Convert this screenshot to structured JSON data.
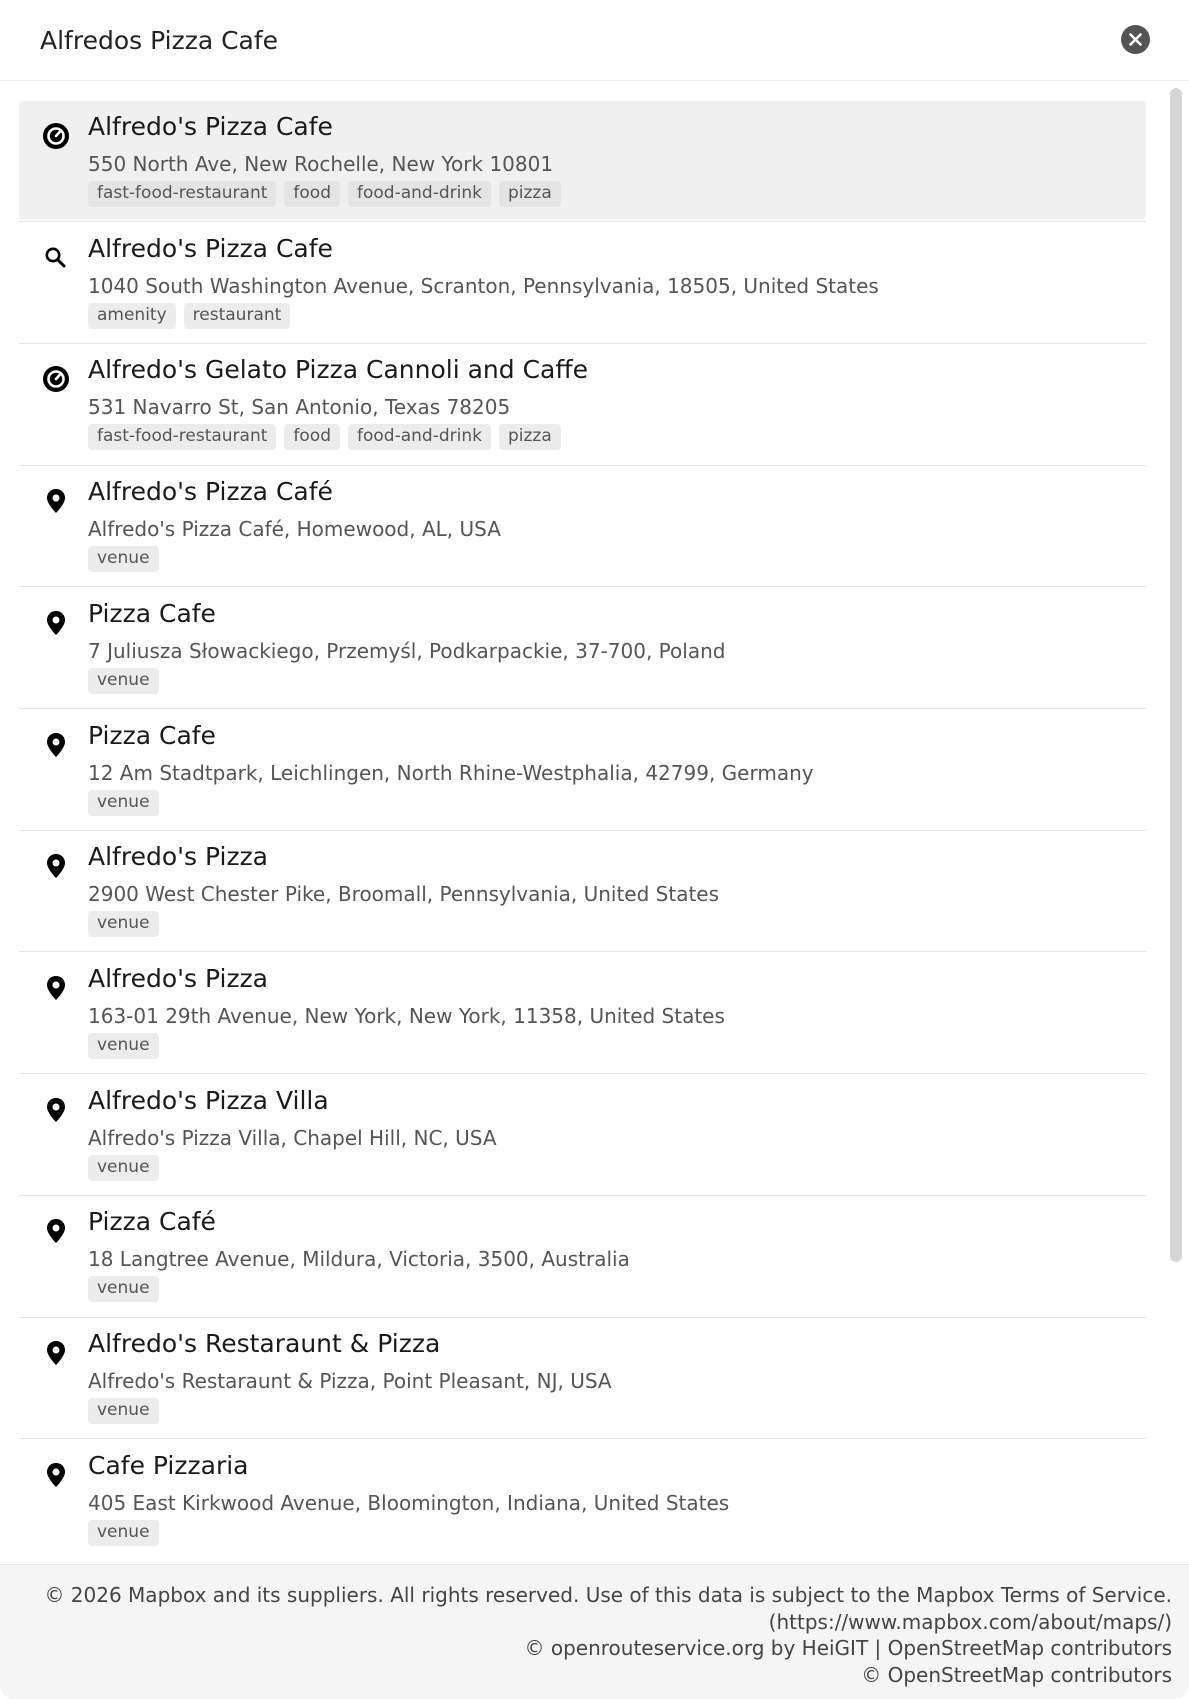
{
  "search": {
    "query": "Alfredos Pizza Cafe"
  },
  "results": [
    {
      "name": "Alfredo's Pizza Cafe",
      "address": "550 North Ave, New Rochelle, New York 10801",
      "icon": "poi-icon",
      "tags": [
        "fast-food-restaurant",
        "food",
        "food-and-drink",
        "pizza"
      ]
    },
    {
      "name": "Alfredo's Pizza Cafe",
      "address": "1040 South Washington Avenue, Scranton, Pennsylvania, 18505, United States",
      "icon": "search-icon",
      "tags": [
        "amenity",
        "restaurant"
      ]
    },
    {
      "name": "Alfredo's Gelato Pizza Cannoli and Caffe",
      "address": "531 Navarro St, San Antonio, Texas 78205",
      "icon": "poi-icon",
      "tags": [
        "fast-food-restaurant",
        "food",
        "food-and-drink",
        "pizza"
      ]
    },
    {
      "name": "Alfredo's Pizza Café",
      "address": "Alfredo's Pizza Café, Homewood, AL, USA",
      "icon": "pin-icon",
      "tags": [
        "venue"
      ]
    },
    {
      "name": "Pizza Cafe",
      "address": "7 Juliusza Słowackiego, Przemyśl, Podkarpackie, 37-700, Poland",
      "icon": "pin-icon",
      "tags": [
        "venue"
      ]
    },
    {
      "name": "Pizza Cafe",
      "address": "12 Am Stadtpark, Leichlingen, North Rhine-Westphalia, 42799, Germany",
      "icon": "pin-icon",
      "tags": [
        "venue"
      ]
    },
    {
      "name": "Alfredo's Pizza",
      "address": "2900 West Chester Pike, Broomall, Pennsylvania, United States",
      "icon": "pin-icon",
      "tags": [
        "venue"
      ]
    },
    {
      "name": "Alfredo's Pizza",
      "address": "163-01 29th Avenue, New York, New York, 11358, United States",
      "icon": "pin-icon",
      "tags": [
        "venue"
      ]
    },
    {
      "name": "Alfredo's Pizza Villa",
      "address": "Alfredo's Pizza Villa, Chapel Hill, NC, USA",
      "icon": "pin-icon",
      "tags": [
        "venue"
      ]
    },
    {
      "name": "Pizza Café",
      "address": "18 Langtree Avenue, Mildura, Victoria, 3500, Australia",
      "icon": "pin-icon",
      "tags": [
        "venue"
      ]
    },
    {
      "name": "Alfredo's Restaraunt & Pizza",
      "address": "Alfredo's Restaraunt & Pizza, Point Pleasant, NJ, USA",
      "icon": "pin-icon",
      "tags": [
        "venue"
      ]
    },
    {
      "name": "Cafe Pizzaria",
      "address": "405 East Kirkwood Avenue, Bloomington, Indiana, United States",
      "icon": "pin-icon",
      "tags": [
        "venue"
      ]
    }
  ],
  "footer": {
    "lines": [
      "© 2026 Mapbox and its suppliers. All rights reserved. Use of this data is subject to the Mapbox Terms of Service.",
      "(https://www.mapbox.com/about/maps/)",
      "© openrouteservice.org by HeiGIT | OpenStreetMap contributors",
      "© OpenStreetMap contributors"
    ]
  },
  "colors": {
    "selected_row": "#f0f0f0",
    "tag_bg": "#ececec",
    "close_bg": "#545454",
    "footer_bg": "#f5f5f5"
  }
}
